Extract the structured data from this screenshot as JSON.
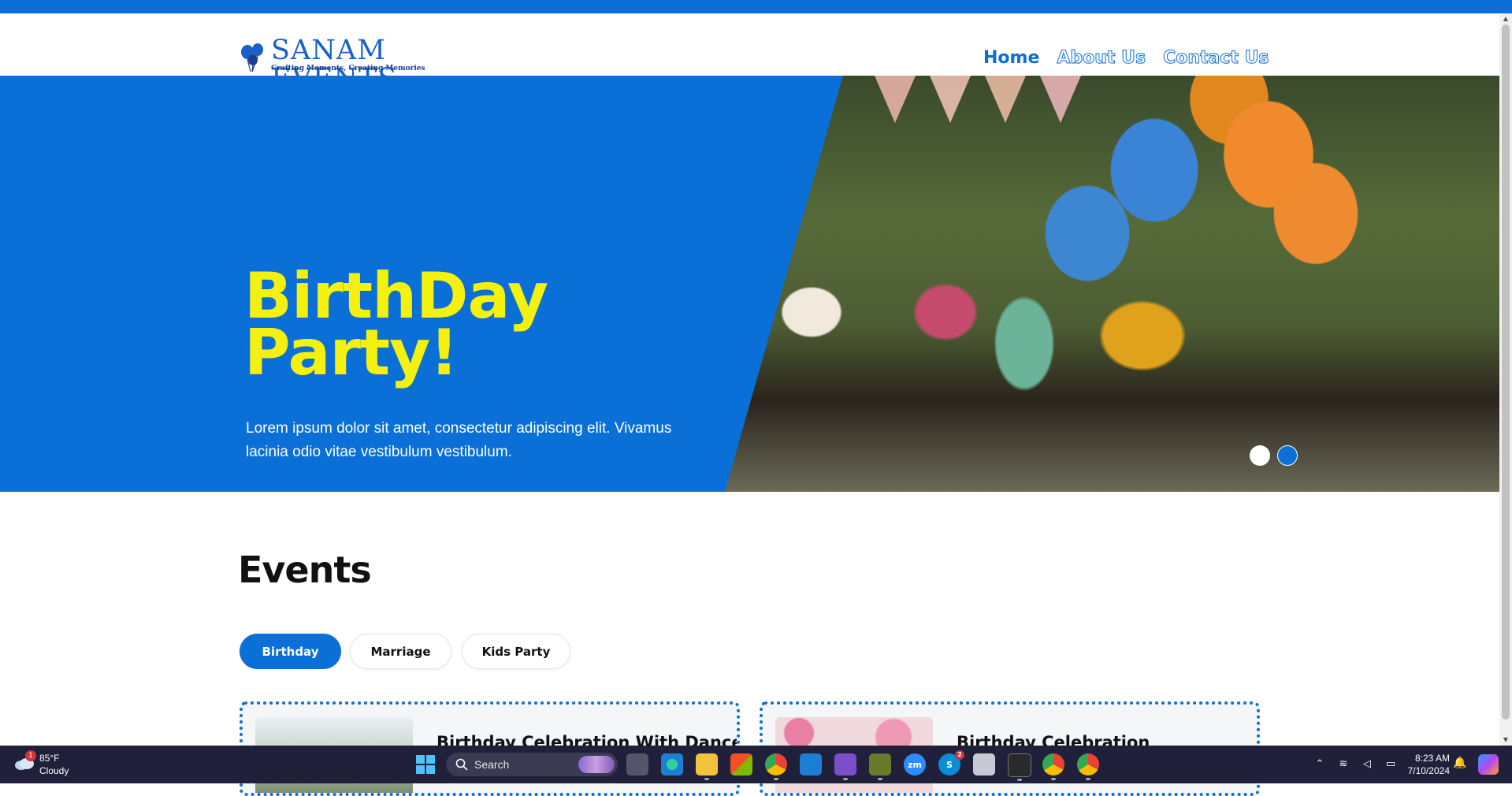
{
  "brand": {
    "name": "SANAM EVENTS",
    "tagline": "Crafting Moments, Creating Memories"
  },
  "nav": {
    "items": [
      {
        "label": "Home",
        "active": true
      },
      {
        "label": "About Us",
        "active": false
      },
      {
        "label": "Contact Us",
        "active": false
      }
    ]
  },
  "hero": {
    "title_line1": "BirthDay",
    "title_line2": "Party!",
    "description": "Lorem ipsum dolor sit amet, consectetur adipiscing elit. Vivamus lacinia odio vitae vestibulum vestibulum.",
    "slides": 2,
    "active_slide": 1
  },
  "events": {
    "title": "Events",
    "tabs": [
      {
        "label": "Birthday",
        "active": true
      },
      {
        "label": "Marriage",
        "active": false
      },
      {
        "label": "Kids Party",
        "active": false
      }
    ],
    "cards": [
      {
        "title": "Birthday Celebration With Dance"
      },
      {
        "title": "Birthday Celebration"
      }
    ]
  },
  "taskbar": {
    "weather": {
      "temp": "85°F",
      "condition": "Cloudy",
      "badge": "1"
    },
    "search_label": "Search",
    "skype_badge": "2",
    "clock": {
      "time": "8:23 AM",
      "date": "7/10/2024"
    }
  },
  "colors": {
    "accent": "#0a6fd6",
    "hero_title": "#f4f10f",
    "taskbar": "#20203a"
  }
}
